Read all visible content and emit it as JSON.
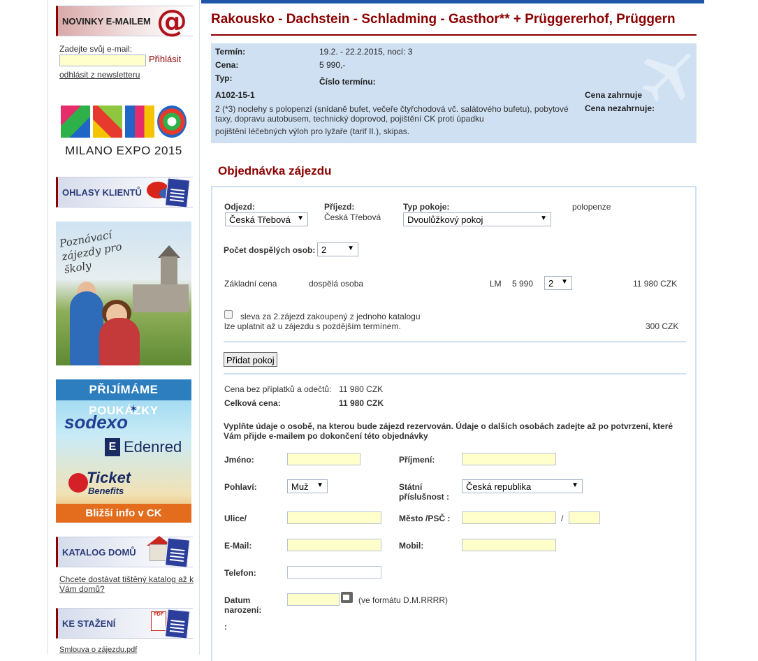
{
  "sidebar": {
    "newsletter": {
      "heading": "NOVINKY E-MAILEM",
      "icon": "at-icon",
      "label": "Zadejte svůj e-mail:",
      "submit": "Přihlásit",
      "unsubscribe": "odhlásit z newsletteru"
    },
    "expo": {
      "caption": "MILANO EXPO 2015"
    },
    "reviews": {
      "heading": "OHLASY KLIENTŮ"
    },
    "school_banner": {
      "text": "Poznávací zájezdy pro školy"
    },
    "vouchers": {
      "heading": "PŘIJÍMÁME POUKÁZKY",
      "brand1": "sodexo",
      "brand2_mark": "E",
      "brand2": "Edenred",
      "brand3": "Ticket",
      "brand3_sub": "Benefits",
      "footer": "Bližší info v CK"
    },
    "catalog": {
      "heading": "KATALOG DOMŮ",
      "link": "Chcete dostávat tištěný katalog až k Vám domů?"
    },
    "downloads": {
      "heading": "KE STAŽENÍ",
      "pdf_label": "PDF",
      "link": "Smlouva o zájezdu.pdf"
    }
  },
  "tour": {
    "title": "Rakousko - Dachstein - Schladming - Gasthor** + Prüggererhof, Prüggern",
    "labels": {
      "term": "Termín:",
      "price": "Cena:",
      "type": "Typ:",
      "term_number": "Číslo termínu:",
      "includes": "Cena zahrnuje",
      "excludes": "Cena nezahrnuje:"
    },
    "term_value": "19.2. - 22.2.2015, nocí: 3",
    "price_value": "5 990,-",
    "code": "A102-15-1",
    "description": "2 (*3) noclehy s polopenzí (snídaně bufet, večeře čtyřchodová vč. salátového bufetu), pobytové taxy, dopravu autobusem, technický doprovod, pojištění CK proti úpadku",
    "excluded_text": "pojištění léčebných výloh pro lyžaře (tarif II.), skipas."
  },
  "order": {
    "title": "Objednávka zájezdu",
    "departure_label": "Odjezd:",
    "departure_value": "Česká Třebová",
    "arrival_label": "Příjezd:",
    "arrival_value": "Česká Třebová",
    "room_label": "Typ pokoje:",
    "room_value": "Dvoulůžkový pokoj",
    "board": "polopenze",
    "adults_label": "Počet dospělých osob:",
    "adults_value": "2",
    "base_price_label": "Základní cena",
    "person_type": "dospělá osoba",
    "price_code": "LM",
    "unit_price": "5 990",
    "qty": "2",
    "line_total": "11 980 CZK",
    "discount_line1": "sleva za 2.zájezd zakoupený z jednoho katalogu",
    "discount_line2": "lze uplatnit až u zájezdu s pozdějším termínem.",
    "discount_value": "300 CZK",
    "add_room": "Přidat pokoj",
    "subtotal_label": "Cena bez příplatků a odečtů:",
    "subtotal": "11 980 CZK",
    "total_label": "Celková cena:",
    "total": "11 980 CZK",
    "instructions": "Vyplňte údaje o osobě, na kterou bude zájezd rezervován. Údaje o dalších osobách zadejte až po potvrzení, které Vám přijde e-mailem po dokončení této objednávky"
  },
  "person": {
    "first_name": "Jméno:",
    "last_name": "Příjmení:",
    "gender": "Pohlaví:",
    "gender_value": "Muž",
    "nationality": "Státní příslušnost :",
    "nationality_value": "Česká republika",
    "street": "Ulice/",
    "city": "Město /PSČ :",
    "slash": "/",
    "email": "E-Mail:",
    "mobile": "Mobil:",
    "phone": "Telefon:",
    "dob": "Datum narození:",
    "dob_hint": "(ve formátu D.M.RRRR)",
    "extra": ":"
  },
  "colors": {
    "accent": "#8b0000",
    "navy": "#2c3e7b",
    "info_bg": "#cfe0f3",
    "field": "#ffffcc"
  }
}
